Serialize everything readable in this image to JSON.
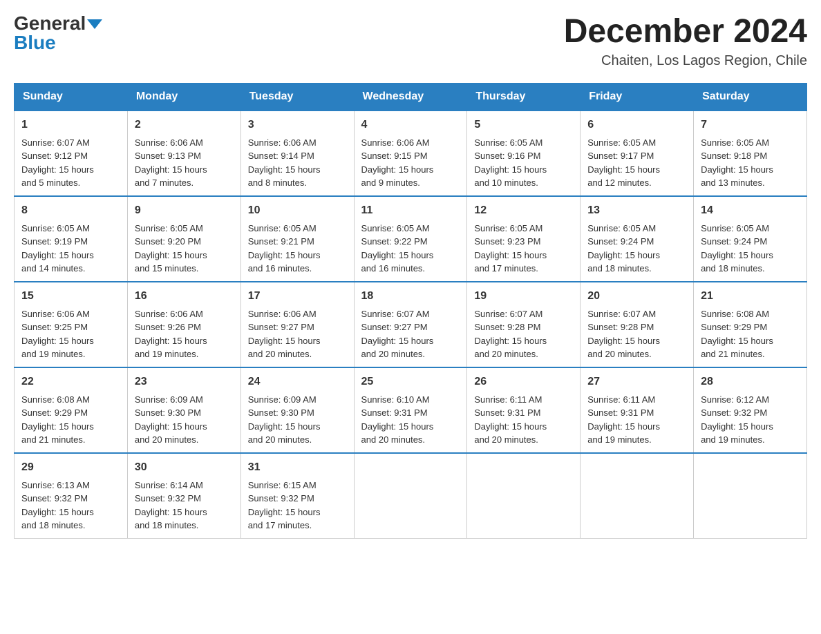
{
  "header": {
    "logo_general": "General",
    "logo_blue": "Blue",
    "title": "December 2024",
    "subtitle": "Chaiten, Los Lagos Region, Chile"
  },
  "calendar": {
    "days_of_week": [
      "Sunday",
      "Monday",
      "Tuesday",
      "Wednesday",
      "Thursday",
      "Friday",
      "Saturday"
    ],
    "weeks": [
      [
        {
          "day": "1",
          "sunrise": "6:07 AM",
          "sunset": "9:12 PM",
          "daylight": "15 hours and 5 minutes."
        },
        {
          "day": "2",
          "sunrise": "6:06 AM",
          "sunset": "9:13 PM",
          "daylight": "15 hours and 7 minutes."
        },
        {
          "day": "3",
          "sunrise": "6:06 AM",
          "sunset": "9:14 PM",
          "daylight": "15 hours and 8 minutes."
        },
        {
          "day": "4",
          "sunrise": "6:06 AM",
          "sunset": "9:15 PM",
          "daylight": "15 hours and 9 minutes."
        },
        {
          "day": "5",
          "sunrise": "6:05 AM",
          "sunset": "9:16 PM",
          "daylight": "15 hours and 10 minutes."
        },
        {
          "day": "6",
          "sunrise": "6:05 AM",
          "sunset": "9:17 PM",
          "daylight": "15 hours and 12 minutes."
        },
        {
          "day": "7",
          "sunrise": "6:05 AM",
          "sunset": "9:18 PM",
          "daylight": "15 hours and 13 minutes."
        }
      ],
      [
        {
          "day": "8",
          "sunrise": "6:05 AM",
          "sunset": "9:19 PM",
          "daylight": "15 hours and 14 minutes."
        },
        {
          "day": "9",
          "sunrise": "6:05 AM",
          "sunset": "9:20 PM",
          "daylight": "15 hours and 15 minutes."
        },
        {
          "day": "10",
          "sunrise": "6:05 AM",
          "sunset": "9:21 PM",
          "daylight": "15 hours and 16 minutes."
        },
        {
          "day": "11",
          "sunrise": "6:05 AM",
          "sunset": "9:22 PM",
          "daylight": "15 hours and 16 minutes."
        },
        {
          "day": "12",
          "sunrise": "6:05 AM",
          "sunset": "9:23 PM",
          "daylight": "15 hours and 17 minutes."
        },
        {
          "day": "13",
          "sunrise": "6:05 AM",
          "sunset": "9:24 PM",
          "daylight": "15 hours and 18 minutes."
        },
        {
          "day": "14",
          "sunrise": "6:05 AM",
          "sunset": "9:24 PM",
          "daylight": "15 hours and 18 minutes."
        }
      ],
      [
        {
          "day": "15",
          "sunrise": "6:06 AM",
          "sunset": "9:25 PM",
          "daylight": "15 hours and 19 minutes."
        },
        {
          "day": "16",
          "sunrise": "6:06 AM",
          "sunset": "9:26 PM",
          "daylight": "15 hours and 19 minutes."
        },
        {
          "day": "17",
          "sunrise": "6:06 AM",
          "sunset": "9:27 PM",
          "daylight": "15 hours and 20 minutes."
        },
        {
          "day": "18",
          "sunrise": "6:07 AM",
          "sunset": "9:27 PM",
          "daylight": "15 hours and 20 minutes."
        },
        {
          "day": "19",
          "sunrise": "6:07 AM",
          "sunset": "9:28 PM",
          "daylight": "15 hours and 20 minutes."
        },
        {
          "day": "20",
          "sunrise": "6:07 AM",
          "sunset": "9:28 PM",
          "daylight": "15 hours and 20 minutes."
        },
        {
          "day": "21",
          "sunrise": "6:08 AM",
          "sunset": "9:29 PM",
          "daylight": "15 hours and 21 minutes."
        }
      ],
      [
        {
          "day": "22",
          "sunrise": "6:08 AM",
          "sunset": "9:29 PM",
          "daylight": "15 hours and 21 minutes."
        },
        {
          "day": "23",
          "sunrise": "6:09 AM",
          "sunset": "9:30 PM",
          "daylight": "15 hours and 20 minutes."
        },
        {
          "day": "24",
          "sunrise": "6:09 AM",
          "sunset": "9:30 PM",
          "daylight": "15 hours and 20 minutes."
        },
        {
          "day": "25",
          "sunrise": "6:10 AM",
          "sunset": "9:31 PM",
          "daylight": "15 hours and 20 minutes."
        },
        {
          "day": "26",
          "sunrise": "6:11 AM",
          "sunset": "9:31 PM",
          "daylight": "15 hours and 20 minutes."
        },
        {
          "day": "27",
          "sunrise": "6:11 AM",
          "sunset": "9:31 PM",
          "daylight": "15 hours and 19 minutes."
        },
        {
          "day": "28",
          "sunrise": "6:12 AM",
          "sunset": "9:32 PM",
          "daylight": "15 hours and 19 minutes."
        }
      ],
      [
        {
          "day": "29",
          "sunrise": "6:13 AM",
          "sunset": "9:32 PM",
          "daylight": "15 hours and 18 minutes."
        },
        {
          "day": "30",
          "sunrise": "6:14 AM",
          "sunset": "9:32 PM",
          "daylight": "15 hours and 18 minutes."
        },
        {
          "day": "31",
          "sunrise": "6:15 AM",
          "sunset": "9:32 PM",
          "daylight": "15 hours and 17 minutes."
        },
        null,
        null,
        null,
        null
      ]
    ],
    "labels": {
      "sunrise": "Sunrise:",
      "sunset": "Sunset:",
      "daylight": "Daylight:"
    }
  }
}
